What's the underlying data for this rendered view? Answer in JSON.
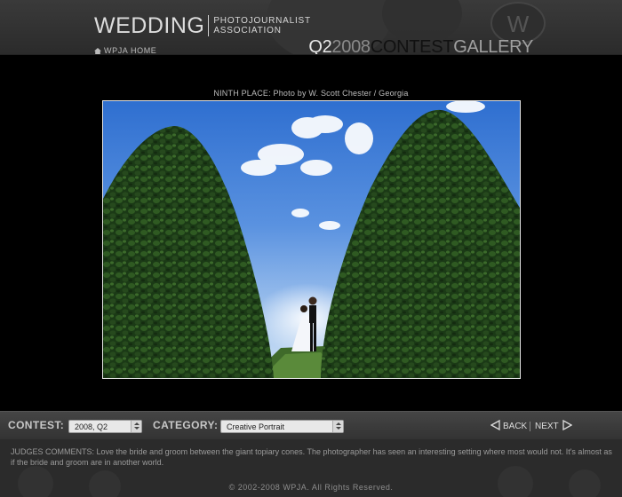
{
  "header": {
    "logo_main": "WEDDING",
    "logo_sub_line1": "PHOTOJOURNALIST",
    "logo_sub_line2": "ASSOCIATION",
    "home_link": "WPJA HOME",
    "title_part1": "Q2",
    "title_part2": "2008",
    "title_part3": "CONTEST",
    "title_part4": "GALLERY",
    "badge_letter": "W"
  },
  "photo": {
    "caption": "NINTH PLACE: Photo by W. Scott Chester / Georgia"
  },
  "controls": {
    "contest_label": "CONTEST:",
    "contest_value": "2008, Q2",
    "category_label": "CATEGORY:",
    "category_value": "Creative Portrait",
    "back_label": "BACK",
    "next_label": "NEXT"
  },
  "comments": {
    "label": "JUDGES COMMENTS:",
    "text": "Love the bride and groom between the giant topiary cones. The photographer has seen an interesting setting where most would not. It's almost as if the bride and groom are in another world."
  },
  "footer": {
    "copyright": "© 2002-2008 WPJA. All Rights Reserved."
  },
  "colors": {
    "header_bg": "#333333",
    "page_bg": "#000000",
    "controls_bg": "#3c3c3c",
    "sky_blue": "#3b78d6",
    "hedge_green": "#1e3d18"
  }
}
